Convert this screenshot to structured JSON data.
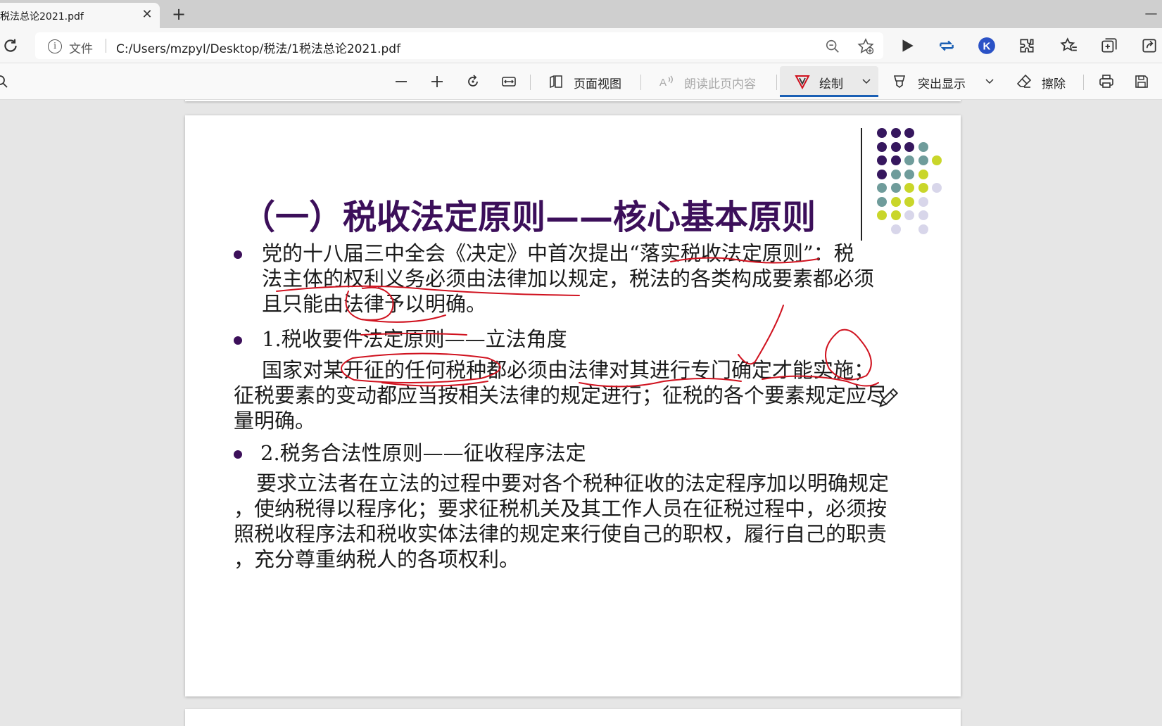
{
  "tab": {
    "title": "税法总论2021.pdf",
    "close": "✕",
    "new": "+"
  },
  "window": {
    "minimize": "—"
  },
  "address": {
    "file_label": "文件",
    "url": "C:/Users/mzpyl/Desktop/税法/1税法总论2021.pdf"
  },
  "pdf_toolbar": {
    "page_view": "页面视图",
    "read_aloud": "朗读此页内容",
    "draw": "绘制",
    "highlight": "突出显示",
    "erase": "擦除"
  },
  "slide": {
    "title": "（一）税收法定原则——核心基本原则",
    "lines": [
      "党的十八届三中全会《决定》中首次提出“落实税收法定原则”：税",
      "法主体的权利义务必须由法律加以规定，税法的各类构成要素都必须",
      "且只能由法律予以明确。",
      "1.税收要件法定原则——立法角度",
      "国家对某开征的任何税种都必须由法律对其进行专门确定才能实施；",
      "征税要素的变动都应当按相关法律的规定进行；征税的各个要素规定应尽",
      "量明确。",
      "2.税务合法性原则——征收程序法定",
      "要求立法者在立法的过程中要对各个税种征收的法定程序加以明确规定",
      "，使纳税得以程序化；要求征税机关及其工作人员在征税过程中，必须按",
      "照税收程序法和税收实体法律的规定来行使自己的职权，履行自己的职责",
      "，充分尊重纳税人的各项权利。"
    ]
  },
  "colors": {
    "title": "#3c0f5a",
    "ink": "#d0121f",
    "dot_purple": "#36175e",
    "dot_teal": "#6f9c9b",
    "dot_lime": "#c9d62a",
    "dot_lavender": "#d8d6ea",
    "accent": "#1a5fb4"
  },
  "icons": [
    "reload-icon",
    "info-icon",
    "zoom-out-icon",
    "add-favorite-icon",
    "play-icon",
    "sync-icon",
    "k-extension-icon",
    "extensions-icon",
    "favorites-icon",
    "collections-icon",
    "share-icon",
    "zoom-minus-icon",
    "zoom-plus-icon",
    "rotate-icon",
    "fit-width-icon",
    "page-view-icon",
    "read-aloud-icon",
    "draw-icon",
    "highlight-icon",
    "erase-icon",
    "print-icon",
    "save-icon",
    "pen-cursor-icon"
  ]
}
